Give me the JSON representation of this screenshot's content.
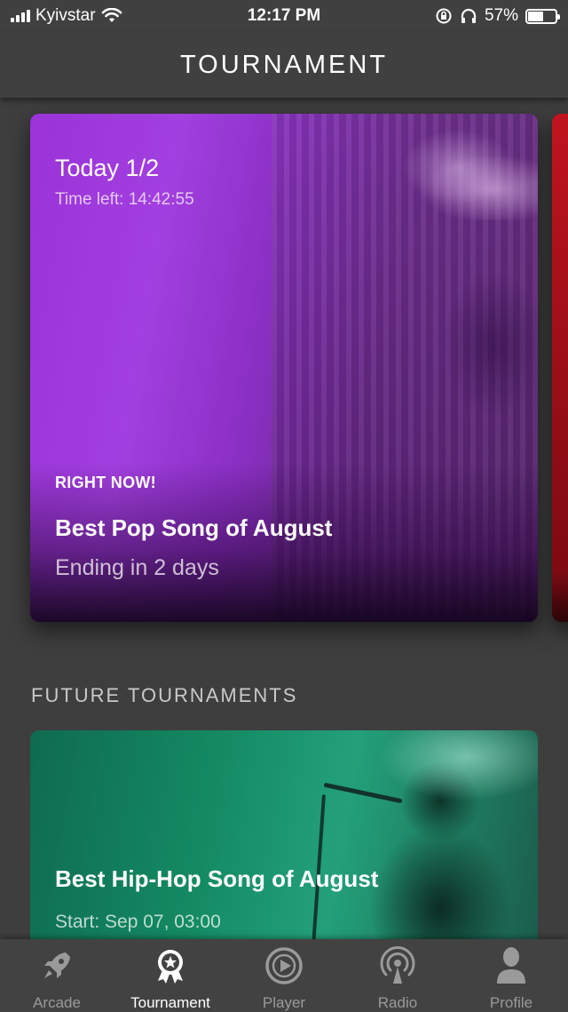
{
  "status_bar": {
    "carrier": "Kyivstar",
    "time": "12:17 PM",
    "battery_percent": "57%",
    "battery_level": 0.57
  },
  "header": {
    "title": "TOURNAMENT"
  },
  "current_tournament": {
    "day": "Today 1/2",
    "time_left": "Time left: 14:42:55",
    "badge": "RIGHT NOW!",
    "title": "Best Pop Song of August",
    "ending": "Ending in 2 days",
    "accent_color": "#9b33d8"
  },
  "future_section": {
    "label": "FUTURE TOURNAMENTS"
  },
  "future_tournament": {
    "title": "Best Hip-Hop Song of August",
    "start": "Start: Sep 07, 03:00",
    "accent_color": "#148a63"
  },
  "tab_bar": {
    "tabs": [
      {
        "label": "Arcade",
        "icon": "rocket-icon",
        "active": false
      },
      {
        "label": "Tournament",
        "icon": "award-icon",
        "active": true
      },
      {
        "label": "Player",
        "icon": "play-circle-icon",
        "active": false
      },
      {
        "label": "Radio",
        "icon": "radio-broadcast-icon",
        "active": false
      },
      {
        "label": "Profile",
        "icon": "person-icon",
        "active": false
      }
    ]
  }
}
